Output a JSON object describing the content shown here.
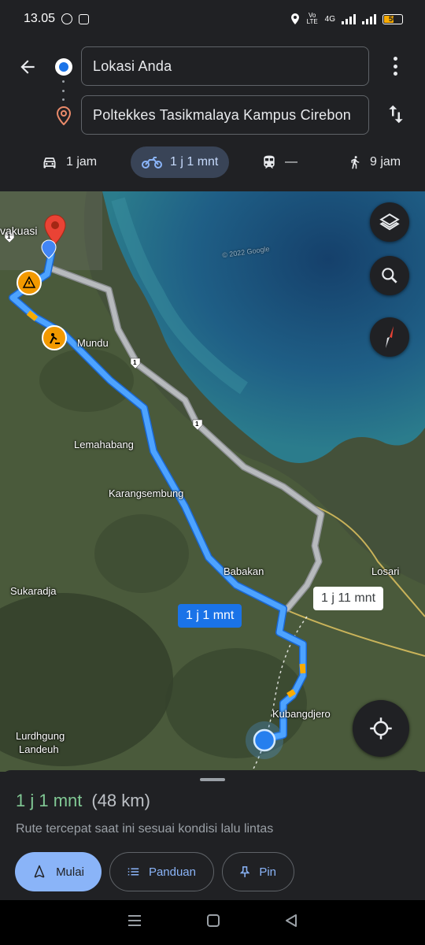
{
  "status_bar": {
    "time": "13.05",
    "network": "4G",
    "volte": "Vo LTE",
    "battery": "50"
  },
  "directions": {
    "origin": "Lokasi Anda",
    "destination": "Poltekkes Tasikmalaya Kampus Cirebon"
  },
  "modes": [
    {
      "name": "car",
      "label": "1 jam"
    },
    {
      "name": "motorcycle",
      "label": "1 j 1 mnt",
      "active": true
    },
    {
      "name": "transit",
      "label": "—"
    },
    {
      "name": "walk",
      "label": "9 jam"
    }
  ],
  "map": {
    "places": [
      "vakuasi",
      "Mundu",
      "Lemahabang",
      "Karangsembung",
      "Babakan",
      "Sukaradja",
      "Losari",
      "Kubangdjero",
      "Lurdhgung",
      "Landeuh"
    ],
    "road_shields": [
      "1",
      "1",
      "1"
    ],
    "route_primary": "1 j 1 mnt",
    "route_alternative": "1 j 11 mnt",
    "watermark": "© 2022 Google",
    "colors": {
      "route": "#4da3ff",
      "alt_route": "#b0b4b8",
      "sea": "#1f5f86"
    }
  },
  "sheet": {
    "time": "1 j 1 mnt",
    "distance": "(48 km)",
    "description": "Rute tercepat saat ini sesuai kondisi lalu lintas",
    "buttons": {
      "start": "Mulai",
      "guide": "Panduan",
      "pin": "Pin"
    }
  }
}
